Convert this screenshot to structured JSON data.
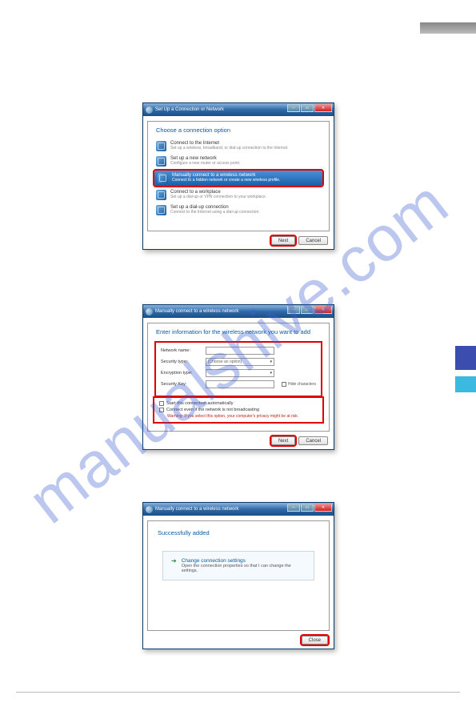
{
  "watermark": "manualshive.com",
  "window1": {
    "title": "Set Up a Connection or Network",
    "heading": "Choose a connection option",
    "options": [
      {
        "title": "Connect to the Internet",
        "sub": "Set up a wireless, broadband, or dial-up connection to the Internet."
      },
      {
        "title": "Set up a new network",
        "sub": "Configure a new router or access point."
      },
      {
        "title": "Manually connect to a wireless network",
        "sub": "Connect to a hidden network or create a new wireless profile."
      },
      {
        "title": "Connect to a workplace",
        "sub": "Set up a dial-up or VPN connection to your workplace."
      },
      {
        "title": "Set up a dial-up connection",
        "sub": "Connect to the Internet using a dial-up connection."
      }
    ],
    "next": "Next",
    "cancel": "Cancel"
  },
  "window2": {
    "title": "Manually connect to a wireless network",
    "heading": "Enter information for the wireless network you want to add",
    "labels": {
      "name": "Network name:",
      "sectype": "Security type:",
      "secplaceholder": "[Choose an option]",
      "enctype": "Encryption type:",
      "seckey": "Security Key:",
      "hidechars": "Hide characters"
    },
    "checks": {
      "auto": "Start this connection automatically",
      "broadcast": "Connect even if the network is not broadcasting",
      "warning": "Warning: If you select this option, your computer's privacy might be at risk."
    },
    "next": "Next",
    "cancel": "Cancel"
  },
  "window3": {
    "title": "Manually connect to a wireless network",
    "success": "Successfully added",
    "link": {
      "title": "Change connection settings",
      "sub": "Open the connection properties so that I can change the settings."
    },
    "close": "Close"
  }
}
